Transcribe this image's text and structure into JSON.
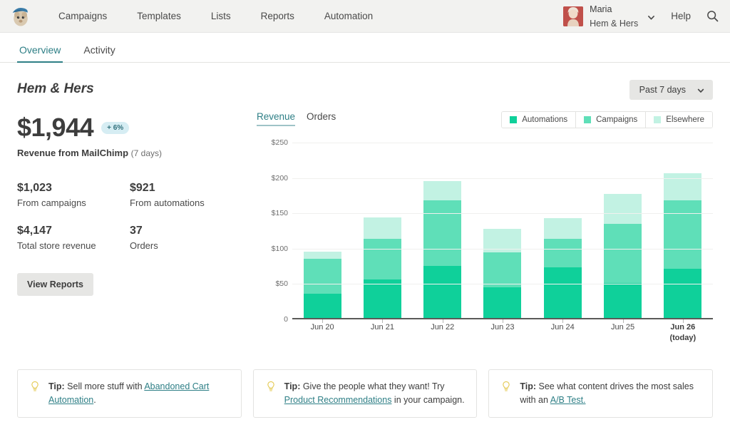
{
  "colors": {
    "automations": "#0fd09a",
    "campaigns": "#5fdfb8",
    "elsewhere": "#c2f2e3",
    "accent": "#2e7f86",
    "navbar_bg": "#f2f2f0",
    "badge_bg": "#d6edf3"
  },
  "topnav": {
    "logo_icon": "mailchimp-freddie-logo",
    "links": [
      {
        "label": "Campaigns"
      },
      {
        "label": "Templates"
      },
      {
        "label": "Lists"
      },
      {
        "label": "Reports"
      },
      {
        "label": "Automation"
      }
    ],
    "user": {
      "avatar_icon": "user-avatar",
      "name": "Maria",
      "org": "Hem & Hers",
      "caret_icon": "chevron-down-icon"
    },
    "help_label": "Help",
    "search_icon": "search-icon"
  },
  "tabs": [
    {
      "label": "Overview",
      "active": true
    },
    {
      "label": "Activity",
      "active": false
    }
  ],
  "page": {
    "store_title": "Hem & Hers",
    "date_range": {
      "label": "Past 7 days",
      "caret_icon": "chevron-down-icon"
    }
  },
  "stats": {
    "headline_value": "$1,944",
    "headline_badge": "+ 6%",
    "headline_label_bold": "Revenue from MailChimp",
    "headline_label_note": "(7 days)",
    "metrics": [
      {
        "value": "$1,023",
        "label": "From campaigns"
      },
      {
        "value": "$921",
        "label": "From automations"
      },
      {
        "value": "$4,147",
        "label": "Total store revenue"
      },
      {
        "value": "37",
        "label": "Orders"
      }
    ],
    "view_reports_label": "View Reports"
  },
  "chart_controls": {
    "subtabs": [
      {
        "label": "Revenue",
        "active": true
      },
      {
        "label": "Orders",
        "active": false
      }
    ],
    "legend": [
      {
        "label": "Automations",
        "color": "#0fd09a"
      },
      {
        "label": "Campaigns",
        "color": "#5fdfb8"
      },
      {
        "label": "Elsewhere",
        "color": "#c2f2e3"
      }
    ]
  },
  "chart_data": {
    "type": "bar",
    "stacked": true,
    "title": "Revenue",
    "xlabel": "",
    "ylabel": "",
    "ylim": [
      0,
      250
    ],
    "grid": true,
    "legend_position": "top-right",
    "ytick_labels": [
      "0",
      "$50",
      "$100",
      "$150",
      "$200",
      "$250"
    ],
    "yticks": [
      0,
      50,
      100,
      150,
      200,
      250
    ],
    "categories": [
      "Jun 20",
      "Jun 21",
      "Jun 22",
      "Jun 23",
      "Jun 24",
      "Jun 25",
      "Jun 26"
    ],
    "category_notes": [
      "",
      "",
      "",
      "",
      "",
      "",
      "(today)"
    ],
    "series": [
      {
        "name": "Automations",
        "color": "#0fd09a",
        "values": [
          34,
          54,
          74,
          43,
          72,
          49,
          70
        ]
      },
      {
        "name": "Campaigns",
        "color": "#5fdfb8",
        "values": [
          50,
          58,
          92,
          50,
          40,
          84,
          96
        ]
      },
      {
        "name": "Elsewhere",
        "color": "#c2f2e3",
        "values": [
          10,
          30,
          28,
          33,
          29,
          42,
          39
        ]
      }
    ],
    "totals": [
      94,
      142,
      194,
      126,
      141,
      175,
      205
    ]
  },
  "tips": [
    {
      "icon": "lightbulb-icon",
      "label": "Tip:",
      "text_before": " Sell more stuff with ",
      "link": "Abandoned Cart Automation",
      "text_after": "."
    },
    {
      "icon": "lightbulb-icon",
      "label": "Tip:",
      "text_before": " Give the people what they want! Try ",
      "link": "Product Recommendations",
      "text_after": " in your campaign."
    },
    {
      "icon": "lightbulb-icon",
      "label": "Tip:",
      "text_before": " See what content drives the most sales with an ",
      "link": "A/B Test.",
      "text_after": ""
    }
  ]
}
